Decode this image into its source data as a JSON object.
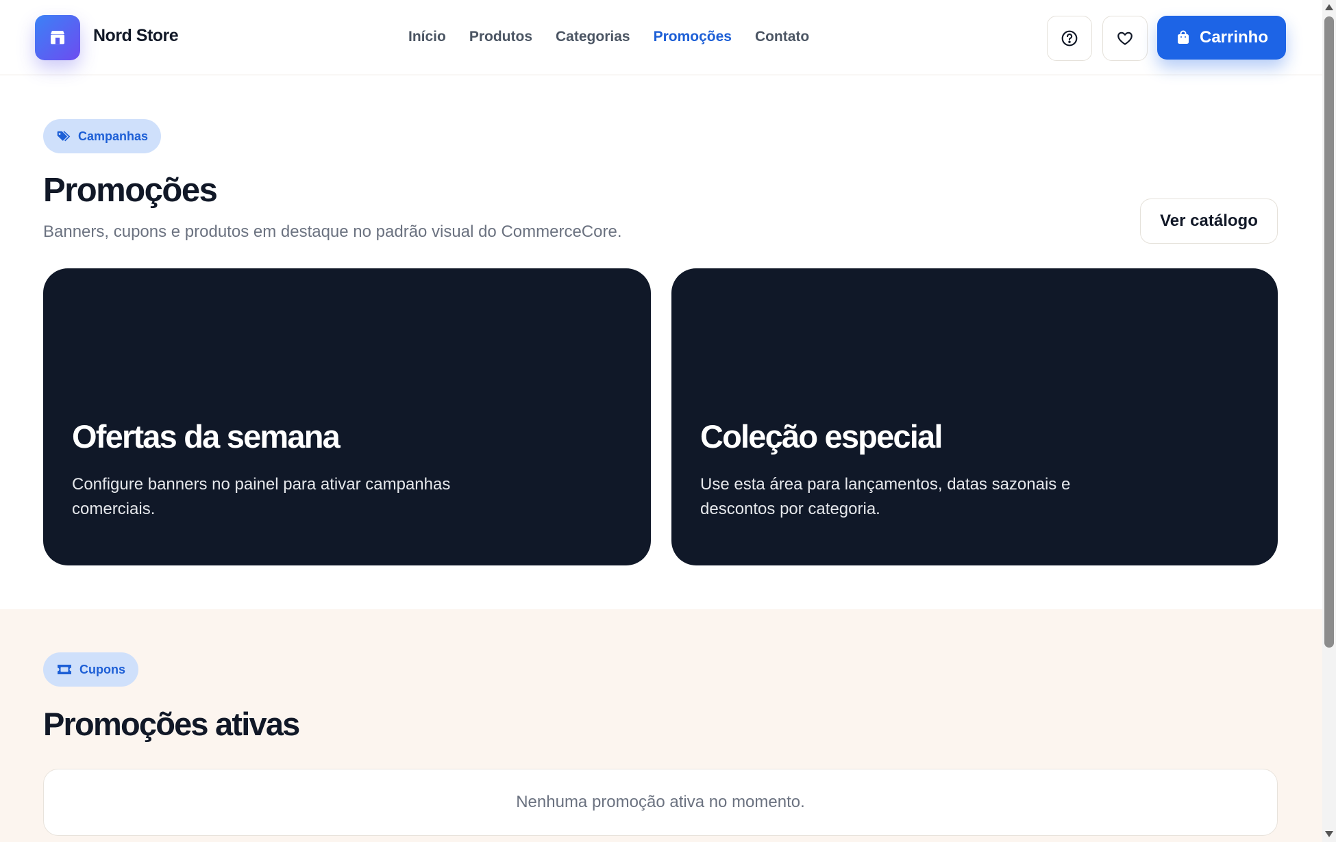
{
  "header": {
    "brand": "Nord Store",
    "nav": [
      {
        "label": "Início",
        "active": false
      },
      {
        "label": "Produtos",
        "active": false
      },
      {
        "label": "Categorias",
        "active": false
      },
      {
        "label": "Promoções",
        "active": true
      },
      {
        "label": "Contato",
        "active": false
      }
    ],
    "cart_label": "Carrinho",
    "icons": [
      "store-icon",
      "help-circle-icon",
      "heart-icon",
      "shopping-bag-icon"
    ]
  },
  "campaigns": {
    "pill_label": "Campanhas",
    "pill_icon": "tags-icon",
    "title": "Promoções",
    "subtitle": "Banners, cupons e produtos em destaque no padrão visual do CommerceCore.",
    "catalog_button": "Ver catálogo",
    "banners": [
      {
        "title": "Ofertas da semana",
        "text": "Configure banners no painel para ativar campanhas comerciais."
      },
      {
        "title": "Coleção especial",
        "text": "Use esta área para lançamentos, datas sazonais e descontos por categoria."
      }
    ]
  },
  "coupons": {
    "pill_label": "Cupons",
    "pill_icon": "ticket-icon",
    "title": "Promoções ativas",
    "empty_message": "Nenhuma promoção ativa no momento."
  },
  "colors": {
    "accent": "#1d64e6",
    "banner_bg": "#101828",
    "section_bg": "#fcf5ef",
    "pill_bg": "#cfe0fb"
  }
}
